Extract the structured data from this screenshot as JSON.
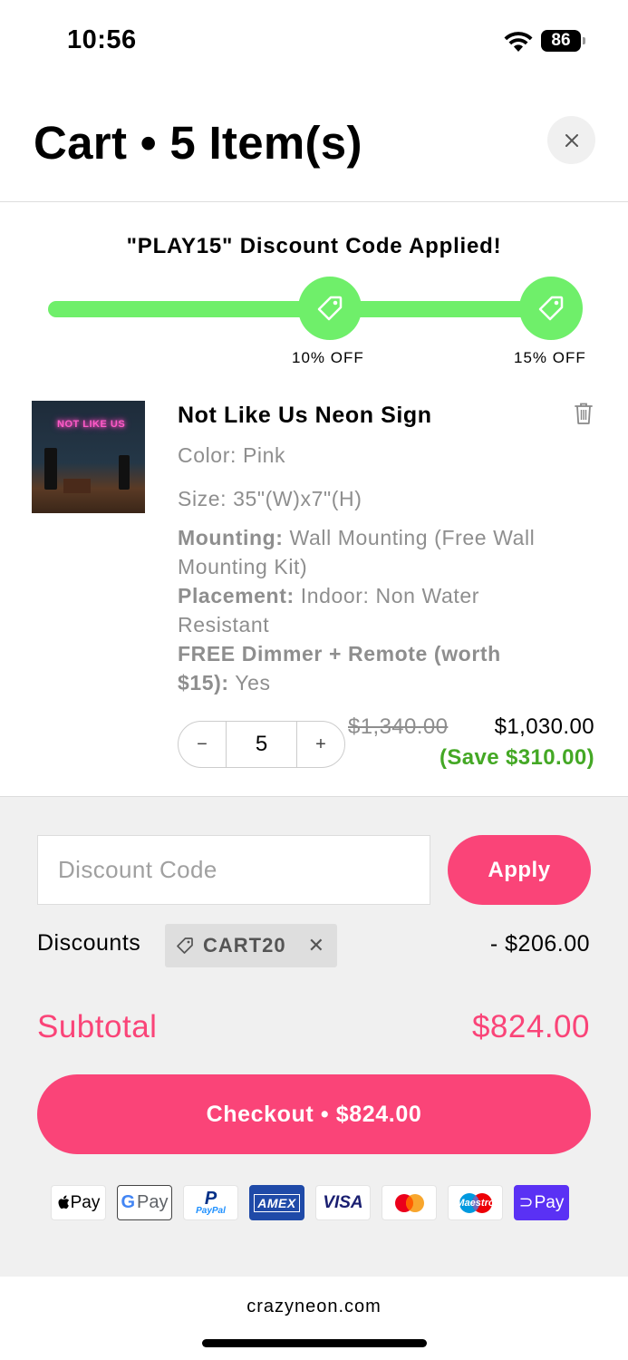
{
  "status": {
    "time": "10:56",
    "battery": "86"
  },
  "header": {
    "title": "Cart • 5 Item(s)"
  },
  "promo": {
    "heading": "\"PLAY15\" Discount Code Applied!",
    "tiers": [
      "10% OFF",
      "15% OFF"
    ],
    "progress": 1.0,
    "color": "#6fef6a"
  },
  "item": {
    "name": "Not Like Us Neon Sign",
    "thumb_text": "NOT LIKE US",
    "color": "Color: Pink",
    "size": "Size: 35\"(W)x7\"(H)",
    "mounting_label": "Mounting:",
    "mounting_value": "Wall Mounting (Free Wall Mounting Kit)",
    "placement_label": "Placement:",
    "placement_value": "Indoor: Non Water Resistant",
    "dimmer_label": "FREE Dimmer + Remote (worth $15):",
    "dimmer_value": "Yes",
    "quantity": "5",
    "minus": "−",
    "plus": "+",
    "price_original": "$1,340.00",
    "price_current": "$1,030.00",
    "savings": "(Save $310.00)"
  },
  "summary": {
    "discount_placeholder": "Discount Code",
    "apply_label": "Apply",
    "discounts_label": "Discounts",
    "discount_code": "CART20",
    "discount_amount": "- $206.00",
    "subtotal_label": "Subtotal",
    "subtotal_amount": "$824.00",
    "checkout_label": "Checkout • $824.00",
    "accent": "#fa4478"
  },
  "payment_methods": [
    {
      "name": "apple-pay",
      "label": "Pay"
    },
    {
      "name": "google-pay",
      "label": "Pay"
    },
    {
      "name": "paypal",
      "label": "PayPal"
    },
    {
      "name": "amex",
      "label": "AMEX"
    },
    {
      "name": "visa",
      "label": "VISA"
    },
    {
      "name": "mastercard",
      "label": ""
    },
    {
      "name": "maestro",
      "label": "Maestro"
    },
    {
      "name": "shop-pay",
      "label": "Pay"
    }
  ],
  "footer": {
    "url": "crazyneon.com"
  }
}
